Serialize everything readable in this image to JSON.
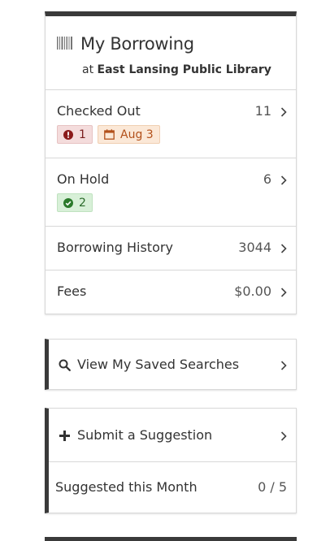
{
  "borrowing": {
    "title": "My Borrowing",
    "subtitle_prefix": "at",
    "library_name": "East Lansing Public Library",
    "checked_out": {
      "label": "Checked Out",
      "count": "11",
      "overdue_count": "1",
      "due_date": "Aug 3"
    },
    "on_hold": {
      "label": "On Hold",
      "count": "6",
      "ready_count": "2"
    },
    "history": {
      "label": "Borrowing History",
      "count": "3044"
    },
    "fees": {
      "label": "Fees",
      "amount": "$0.00"
    }
  },
  "saved_searches": {
    "label": "View My Saved Searches"
  },
  "suggestions": {
    "label": "Submit a Suggestion",
    "month_label": "Suggested this Month",
    "month_value": "0 / 5"
  },
  "colors": {
    "dark_bar": "#3a3a3a",
    "overdue_bg": "#f4dcdc",
    "due_bg": "#fbe8d7",
    "ready_bg": "#d8f0d8"
  },
  "icons": [
    "barcode-icon",
    "chevron-right-icon",
    "exclamation-circle-icon",
    "calendar-icon",
    "check-circle-icon",
    "search-icon",
    "plus-icon"
  ]
}
